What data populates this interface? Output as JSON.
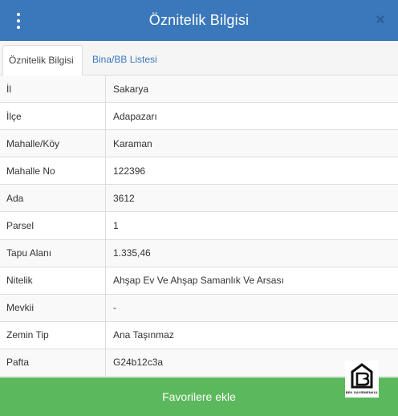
{
  "header": {
    "title": "Öznitelik Bilgisi",
    "close_glyph": "×"
  },
  "tabs": [
    {
      "label": "Öznitelik Bilgisi",
      "active": true
    },
    {
      "label": "Bina/BB Listesi",
      "active": false
    }
  ],
  "attributes": [
    {
      "key": "İl",
      "value": "Sakarya"
    },
    {
      "key": "İlçe",
      "value": "Adapazarı"
    },
    {
      "key": "Mahalle/Köy",
      "value": "Karaman"
    },
    {
      "key": "Mahalle No",
      "value": "122396"
    },
    {
      "key": "Ada",
      "value": "3612"
    },
    {
      "key": "Parsel",
      "value": "1"
    },
    {
      "key": "Tapu Alanı",
      "value": "1.335,46"
    },
    {
      "key": "Nitelik",
      "value": "Ahşap Ev Ve Ahşap Samanlık Ve Arsası"
    },
    {
      "key": "Mevkii",
      "value": "-"
    },
    {
      "key": "Zemin Tip",
      "value": "Ana Taşınmaz"
    },
    {
      "key": "Pafta",
      "value": "G24b12c3a"
    }
  ],
  "footer": {
    "button_label": "Favorilere ekle"
  },
  "logo": {
    "text": "BEK GAYRİMENKUL"
  },
  "colors": {
    "header": "#3a78bb",
    "button": "#5cb85c",
    "link": "#3a78bb"
  },
  "icons": {
    "menu": "vertical-dots-icon",
    "close": "close-icon"
  }
}
